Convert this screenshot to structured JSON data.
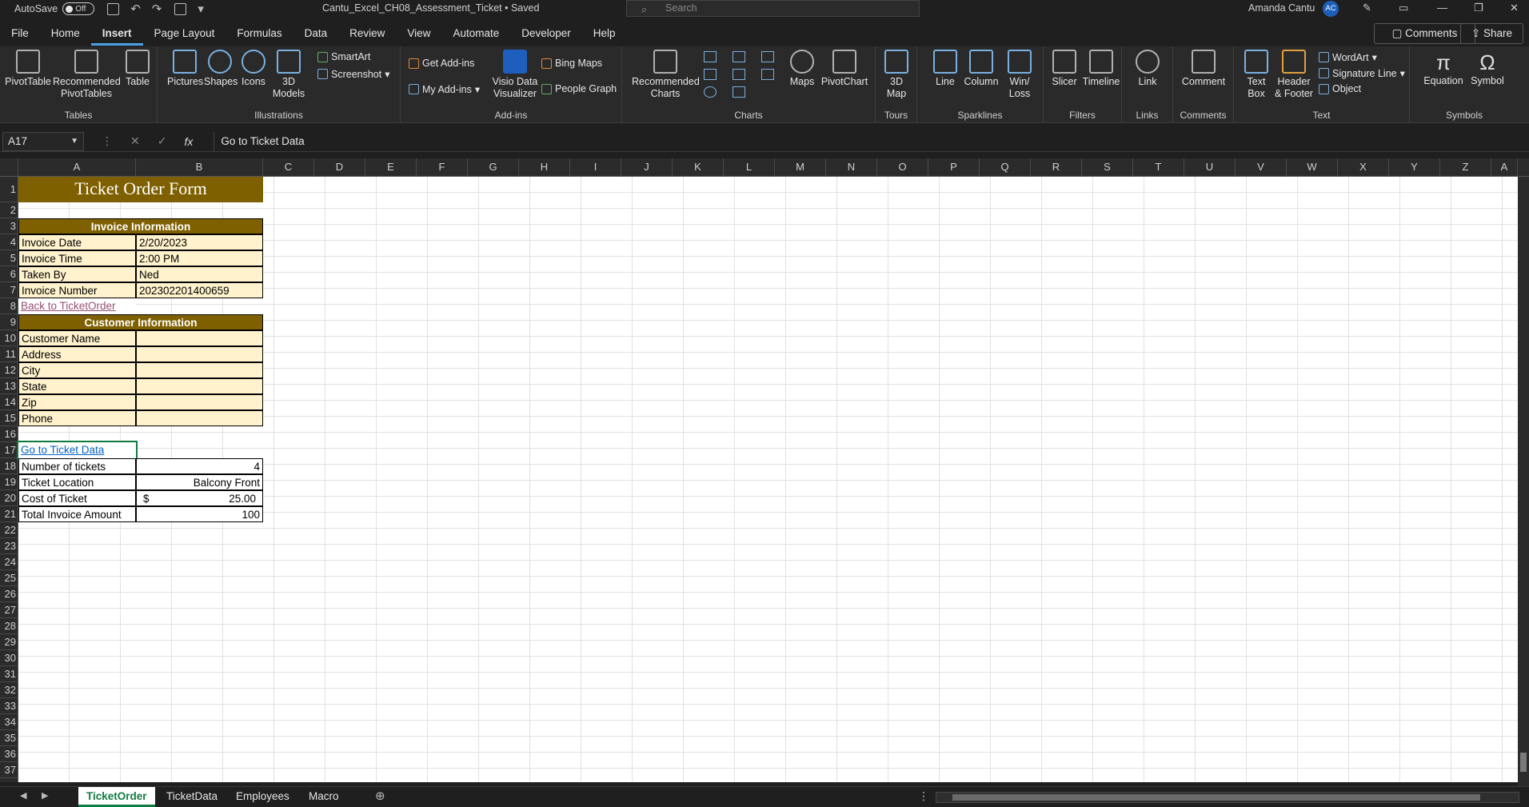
{
  "titlebar": {
    "autosave_label": "AutoSave",
    "autosave_state": "Off",
    "doc_title": "Cantu_Excel_CH08_Assessment_Ticket • Saved",
    "search_placeholder": "Search",
    "user_name": "Amanda Cantu",
    "user_initials": "AC"
  },
  "menu": {
    "items": [
      "File",
      "Home",
      "Insert",
      "Page Layout",
      "Formulas",
      "Data",
      "Review",
      "View",
      "Automate",
      "Developer",
      "Help"
    ],
    "active": "Insert",
    "comments": "Comments",
    "share": "Share"
  },
  "ribbon": {
    "tables": {
      "label": "Tables",
      "pivottable": "PivotTable",
      "recommended_pivot": "Recommended PivotTables",
      "table": "Table"
    },
    "illustrations": {
      "label": "Illustrations",
      "pictures": "Pictures",
      "shapes": "Shapes",
      "icons": "Icons",
      "models": "3D Models",
      "smartart": "SmartArt",
      "screenshot": "Screenshot"
    },
    "addins": {
      "label": "Add-ins",
      "get": "Get Add-ins",
      "my": "My Add-ins",
      "visio": "Visio Data Visualizer",
      "bing": "Bing Maps",
      "people": "People Graph"
    },
    "charts": {
      "label": "Charts",
      "recommended": "Recommended Charts",
      "maps": "Maps",
      "pivotchart": "PivotChart"
    },
    "tours": {
      "label": "Tours",
      "map3d": "3D Map"
    },
    "sparklines": {
      "label": "Sparklines",
      "line": "Line",
      "column": "Column",
      "winloss": "Win/ Loss"
    },
    "filters": {
      "label": "Filters",
      "slicer": "Slicer",
      "timeline": "Timeline"
    },
    "links": {
      "label": "Links",
      "link": "Link"
    },
    "comments": {
      "label": "Comments",
      "comment": "Comment"
    },
    "text": {
      "label": "Text",
      "textbox": "Text Box",
      "header": "Header & Footer",
      "wordart": "WordArt",
      "signature": "Signature Line",
      "object": "Object"
    },
    "symbols": {
      "label": "Symbols",
      "equation": "Equation",
      "symbol": "Symbol"
    }
  },
  "formula_bar": {
    "name_box": "A17",
    "formula": "Go to Ticket Data"
  },
  "columns": [
    "A",
    "B",
    "C",
    "D",
    "E",
    "F",
    "G",
    "H",
    "I",
    "J",
    "K",
    "L",
    "M",
    "N",
    "O",
    "P",
    "Q",
    "R",
    "S",
    "T",
    "U",
    "V",
    "W",
    "X",
    "Y",
    "Z",
    "A"
  ],
  "rows": [
    "1",
    "2",
    "3",
    "4",
    "5",
    "6",
    "7",
    "8",
    "9",
    "10",
    "11",
    "12",
    "13",
    "14",
    "15",
    "16",
    "17",
    "18",
    "19",
    "20",
    "21",
    "22",
    "23",
    "24",
    "25",
    "26",
    "27",
    "28",
    "29",
    "30",
    "31",
    "32",
    "33",
    "34",
    "35",
    "36",
    "37"
  ],
  "sheet": {
    "title": "Ticket Order Form",
    "invoice_header": "Invoice Information",
    "invoice": [
      {
        "label": "Invoice Date",
        "value": "2/20/2023"
      },
      {
        "label": "Invoice Time",
        "value": "2:00 PM"
      },
      {
        "label": "Taken By",
        "value": "Ned"
      },
      {
        "label": "Invoice Number",
        "value": "202302201400659"
      }
    ],
    "back_link": "Back to TicketOrder",
    "customer_header": "Customer Information",
    "customer": [
      "Customer Name",
      "Address",
      "City",
      "State",
      "Zip",
      "Phone"
    ],
    "ticket_link": "Go to Ticket Data",
    "tickets": [
      {
        "label": "Number of tickets",
        "value": "4"
      },
      {
        "label": "Ticket Location",
        "value": "Balcony Front"
      },
      {
        "label": "Cost of Ticket",
        "currency": "$",
        "value": "25.00"
      },
      {
        "label": "Total Invoice Amount",
        "value": "100"
      }
    ]
  },
  "tabs": [
    "TicketOrder",
    "TicketData",
    "Employees",
    "Macro"
  ],
  "active_tab": "TicketOrder",
  "colors": {
    "header_fill": "#7f6000",
    "label_fill": "#fff2cc",
    "accent": "#107c41"
  }
}
